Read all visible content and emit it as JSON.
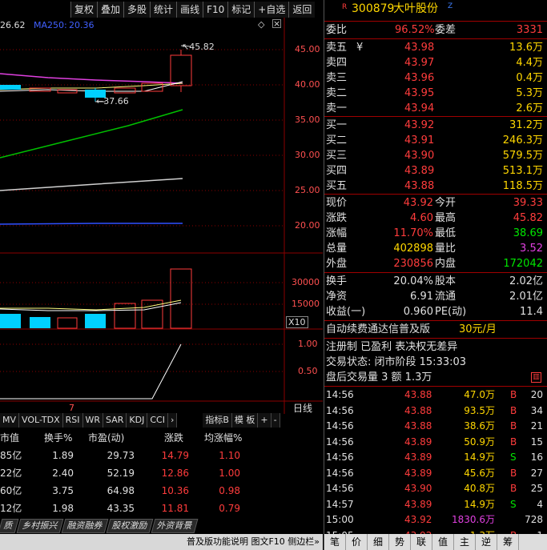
{
  "toolbar": [
    "复权",
    "叠加",
    "多股",
    "统计",
    "画线",
    "F10",
    "标记",
    "+自选",
    "返回"
  ],
  "chart": {
    "ma_labels": {
      "a": "26.62",
      "b_name": "MA250:",
      "b_val": "20.36"
    },
    "y_price_ticks": [
      "45.00",
      "40.00",
      "35.00",
      "30.00",
      "25.00",
      "20.00"
    ],
    "high_marker": "45.82",
    "low_marker": "37.66",
    "y_vol_ticks": [
      "30000",
      "15000"
    ],
    "vol_unit": "X10",
    "y_ind_ticks": [
      "1.00",
      "0.50"
    ],
    "x_label": "7",
    "period": "日线"
  },
  "indicator_tabs": [
    "MV",
    "VOL-TDX",
    "RSI",
    "WR",
    "SAR",
    "KDJ",
    "CCI",
    "›",
    "指标B",
    "模 板",
    "+",
    "-"
  ],
  "table": {
    "headers": [
      "市值",
      "换手%",
      "市盈(动)",
      "涨跌",
      "均涨幅%"
    ],
    "rows": [
      [
        "85亿",
        "1.89",
        "29.73",
        "14.79",
        "1.10"
      ],
      [
        "22亿",
        "2.40",
        "52.19",
        "12.86",
        "1.00"
      ],
      [
        "60亿",
        "3.75",
        "64.98",
        "10.36",
        "0.98"
      ],
      [
        "12亿",
        "1.98",
        "43.35",
        "11.81",
        "0.79"
      ]
    ]
  },
  "bottom_tabs": [
    "质",
    "乡村振兴",
    "融资融券",
    "股权激励",
    "外资背景"
  ],
  "status_bar": "普及版功能说明 图文F10 侧边栏»",
  "quote": {
    "badge_r": "R",
    "code": "300879",
    "name": "大叶股份",
    "badge_z": "Z",
    "weibi_label": "委比",
    "weibi": "96.52%",
    "weicha_label": "委差",
    "weicha": "3331",
    "sell": [
      {
        "label": "卖五",
        "price": "43.98",
        "vol": "13.6万",
        "mark": "¥"
      },
      {
        "label": "卖四",
        "price": "43.97",
        "vol": "4.4万"
      },
      {
        "label": "卖三",
        "price": "43.96",
        "vol": "0.4万"
      },
      {
        "label": "卖二",
        "price": "43.95",
        "vol": "5.3万"
      },
      {
        "label": "卖一",
        "price": "43.94",
        "vol": "2.6万"
      }
    ],
    "buy": [
      {
        "label": "买一",
        "price": "43.92",
        "vol": "31.2万"
      },
      {
        "label": "买二",
        "price": "43.91",
        "vol": "246.3万"
      },
      {
        "label": "买三",
        "price": "43.90",
        "vol": "579.5万"
      },
      {
        "label": "买四",
        "price": "43.89",
        "vol": "513.1万"
      },
      {
        "label": "买五",
        "price": "43.88",
        "vol": "118.5万"
      }
    ],
    "stats": [
      {
        "l1": "现价",
        "v1": "43.92",
        "l2": "今开",
        "v2": "39.33",
        "c1": "red",
        "c2": "red"
      },
      {
        "l1": "涨跌",
        "v1": "4.60",
        "l2": "最高",
        "v2": "45.82",
        "c1": "red",
        "c2": "red"
      },
      {
        "l1": "涨幅",
        "v1": "11.70%",
        "l2": "最低",
        "v2": "38.69",
        "c1": "red",
        "c2": "green"
      },
      {
        "l1": "总量",
        "v1": "402898",
        "l2": "量比",
        "v2": "3.52",
        "c1": "yellow",
        "c2": "mag"
      },
      {
        "l1": "外盘",
        "v1": "230856",
        "l2": "内盘",
        "v2": "172042",
        "c1": "red",
        "c2": "green"
      }
    ],
    "fund": [
      {
        "l1": "换手",
        "v1": "20.04%",
        "l2": "股本",
        "v2": "2.02亿"
      },
      {
        "l1": "净资",
        "v1": "6.91",
        "l2": "流通",
        "v2": "2.01亿"
      },
      {
        "l1": "收益(一)",
        "v1": "0.960",
        "l2": "PE(动)",
        "v2": "11.4"
      }
    ],
    "promo_text": "自动续费通达信普及版",
    "promo_price": "30元/月",
    "info": [
      "注册制 已盈利 表决权无差异",
      "交易状态: 闭市阶段 15:33:03",
      "盘后交易量 3 额 1.3万"
    ],
    "info_icon": "chart-icon",
    "ticks": [
      {
        "t": "14:56",
        "p": "43.88",
        "v": "47.0万",
        "d": "B",
        "n": "20"
      },
      {
        "t": "14:56",
        "p": "43.88",
        "v": "93.5万",
        "d": "B",
        "n": "34"
      },
      {
        "t": "14:56",
        "p": "43.88",
        "v": "38.6万",
        "d": "B",
        "n": "21"
      },
      {
        "t": "14:56",
        "p": "43.89",
        "v": "50.9万",
        "d": "B",
        "n": "15"
      },
      {
        "t": "14:56",
        "p": "43.89",
        "v": "14.9万",
        "d": "S",
        "n": "16"
      },
      {
        "t": "14:56",
        "p": "43.89",
        "v": "45.6万",
        "d": "B",
        "n": "27"
      },
      {
        "t": "14:56",
        "p": "43.90",
        "v": "40.8万",
        "d": "B",
        "n": "25"
      },
      {
        "t": "14:57",
        "p": "43.89",
        "v": "14.9万",
        "d": "S",
        "n": "4"
      },
      {
        "t": "15:00",
        "p": "43.92",
        "v": "1830.6万",
        "d": "",
        "n": "728"
      },
      {
        "t": "15:05",
        "p": "43.92",
        "v": "1.3万",
        "d": "B",
        "n": "1"
      }
    ],
    "bottom_tabs": [
      "笔",
      "价",
      "细",
      "势",
      "联",
      "值",
      "主",
      "逆",
      "筹"
    ]
  },
  "colors": {
    "up": "#ff3c3c",
    "down": "#00e600",
    "bg": "#000000",
    "grid": "#8b0000"
  }
}
